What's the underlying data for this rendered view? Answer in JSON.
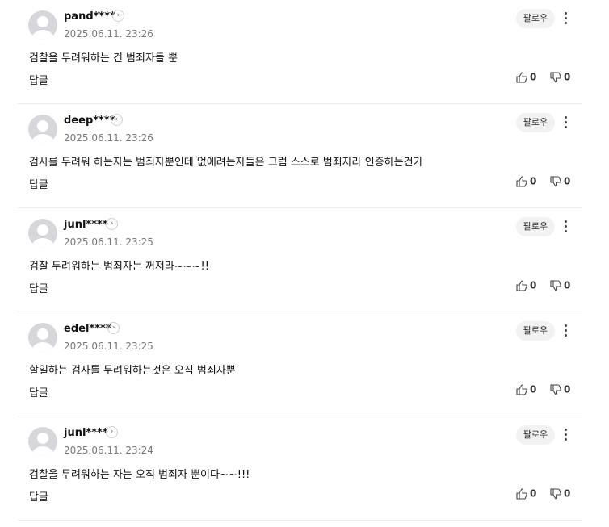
{
  "comments": [
    {
      "author": "pand****",
      "date": "2025.06.11. 23:26",
      "text": "검찰을 두려워하는 건 범죄자들 뿐",
      "follow": "팔로우",
      "reply": "답글",
      "likes": "0",
      "dislikes": "0"
    },
    {
      "author": "deep****",
      "date": "2025.06.11. 23:26",
      "text": "검사를 두려워 하는자는 범죄자뿐인데 없애려는자들은 그럼 스스로 범죄자라 인증하는건가",
      "follow": "팔로우",
      "reply": "답글",
      "likes": "0",
      "dislikes": "0"
    },
    {
      "author": "junl****",
      "date": "2025.06.11. 23:25",
      "text": "검찰 두려워하는 범죄자는 꺼져라~~~!!",
      "follow": "팔로우",
      "reply": "답글",
      "likes": "0",
      "dislikes": "0"
    },
    {
      "author": "edel****",
      "date": "2025.06.11. 23:25",
      "text": "할일하는 검사를 두려워하는것은 오직 범죄자뿐",
      "follow": "팔로우",
      "reply": "답글",
      "likes": "0",
      "dislikes": "0"
    },
    {
      "author": "junl****",
      "date": "2025.06.11. 23:24",
      "text": "검찰을 두려워하는 자는 오직 범죄자 뿐이다~~!!!",
      "follow": "팔로우",
      "reply": "답글",
      "likes": "0",
      "dislikes": "0"
    }
  ],
  "icons": {
    "profile": "chevron-right-icon",
    "more": "more-vertical-icon",
    "like": "thumbs-up-icon",
    "dislike": "thumbs-down-icon",
    "avatar": "default-avatar-icon"
  }
}
